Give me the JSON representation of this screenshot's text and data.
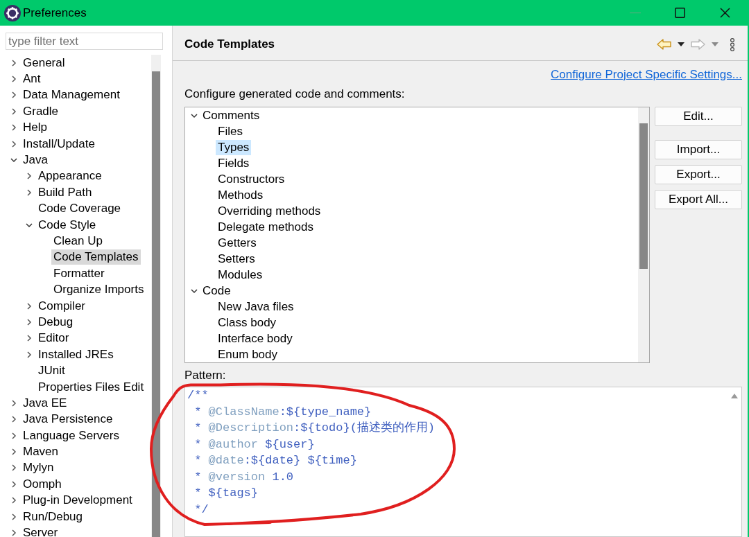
{
  "window": {
    "title": "Preferences"
  },
  "sidebar": {
    "filter": {
      "placeholder": "type filter text"
    },
    "items": [
      {
        "label": "General",
        "expanded": false,
        "selected": false
      },
      {
        "label": "Ant",
        "expanded": false,
        "selected": false
      },
      {
        "label": "Data Management",
        "expanded": false,
        "selected": false
      },
      {
        "label": "Gradle",
        "expanded": false,
        "selected": false
      },
      {
        "label": "Help",
        "expanded": false,
        "selected": false
      },
      {
        "label": "Install/Update",
        "expanded": false,
        "selected": false
      },
      {
        "label": "Java",
        "expanded": true,
        "selected": false,
        "children": [
          {
            "label": "Appearance",
            "expanded": false,
            "selected": false
          },
          {
            "label": "Build Path",
            "expanded": false,
            "selected": false
          },
          {
            "label": "Code Coverage",
            "selected": false
          },
          {
            "label": "Code Style",
            "expanded": true,
            "selected": false,
            "children": [
              {
                "label": "Clean Up",
                "selected": false
              },
              {
                "label": "Code Templates",
                "selected": true
              },
              {
                "label": "Formatter",
                "selected": false
              },
              {
                "label": "Organize Imports",
                "selected": false
              }
            ]
          },
          {
            "label": "Compiler",
            "expanded": false,
            "selected": false
          },
          {
            "label": "Debug",
            "expanded": false,
            "selected": false
          },
          {
            "label": "Editor",
            "expanded": false,
            "selected": false
          },
          {
            "label": "Installed JREs",
            "expanded": false,
            "selected": false
          },
          {
            "label": "JUnit",
            "selected": false
          },
          {
            "label": "Properties Files Edit",
            "selected": false
          }
        ]
      },
      {
        "label": "Java EE",
        "expanded": false,
        "selected": false
      },
      {
        "label": "Java Persistence",
        "expanded": false,
        "selected": false
      },
      {
        "label": "Language Servers",
        "expanded": false,
        "selected": false
      },
      {
        "label": "Maven",
        "expanded": false,
        "selected": false
      },
      {
        "label": "Mylyn",
        "expanded": false,
        "selected": false
      },
      {
        "label": "Oomph",
        "expanded": false,
        "selected": false
      },
      {
        "label": "Plug-in Development",
        "expanded": false,
        "selected": false
      },
      {
        "label": "Run/Debug",
        "expanded": false,
        "selected": false
      },
      {
        "label": "Server",
        "expanded": false,
        "selected": false
      }
    ]
  },
  "page": {
    "title": "Code Templates",
    "link": "Configure Project Specific Settings...",
    "label": "Configure generated code and comments:",
    "templates": [
      {
        "label": "Comments",
        "expanded": true,
        "selected": false,
        "children": [
          {
            "label": "Files",
            "selected": false
          },
          {
            "label": "Types",
            "selected": true
          },
          {
            "label": "Fields",
            "selected": false
          },
          {
            "label": "Constructors",
            "selected": false
          },
          {
            "label": "Methods",
            "selected": false
          },
          {
            "label": "Overriding methods",
            "selected": false
          },
          {
            "label": "Delegate methods",
            "selected": false
          },
          {
            "label": "Getters",
            "selected": false
          },
          {
            "label": "Setters",
            "selected": false
          },
          {
            "label": "Modules",
            "selected": false
          }
        ]
      },
      {
        "label": "Code",
        "expanded": true,
        "selected": false,
        "children": [
          {
            "label": "New Java files",
            "selected": false
          },
          {
            "label": "Class body",
            "selected": false
          },
          {
            "label": "Interface body",
            "selected": false
          },
          {
            "label": "Enum body",
            "selected": false
          }
        ]
      }
    ],
    "button_groups": [
      {
        "buttons": [
          "Edit..."
        ]
      },
      {
        "buttons": [
          "Import...",
          "Export...",
          "Export All..."
        ]
      }
    ],
    "pattern": {
      "label": "Pattern:",
      "lines": [
        [
          {
            "kind": "text",
            "text": "/**"
          }
        ],
        [
          {
            "kind": "text",
            "text": " * "
          },
          {
            "kind": "tag",
            "text": "@ClassName"
          },
          {
            "kind": "text",
            "text": ":${type_name}"
          }
        ],
        [
          {
            "kind": "text",
            "text": " * "
          },
          {
            "kind": "tag",
            "text": "@Description"
          },
          {
            "kind": "text",
            "text": ":${todo}(描述类的作用)"
          }
        ],
        [
          {
            "kind": "text",
            "text": " * "
          },
          {
            "kind": "tag",
            "text": "@author"
          },
          {
            "kind": "text",
            "text": " ${user}"
          }
        ],
        [
          {
            "kind": "text",
            "text": " * "
          },
          {
            "kind": "tag",
            "text": "@date"
          },
          {
            "kind": "text",
            "text": ":${date} ${time}"
          }
        ],
        [
          {
            "kind": "text",
            "text": " * "
          },
          {
            "kind": "tag",
            "text": "@version"
          },
          {
            "kind": "text",
            "text": " 1.0"
          }
        ],
        [
          {
            "kind": "text",
            "text": " * ${tags}"
          }
        ],
        [
          {
            "kind": "text",
            "text": " */"
          }
        ]
      ]
    }
  }
}
